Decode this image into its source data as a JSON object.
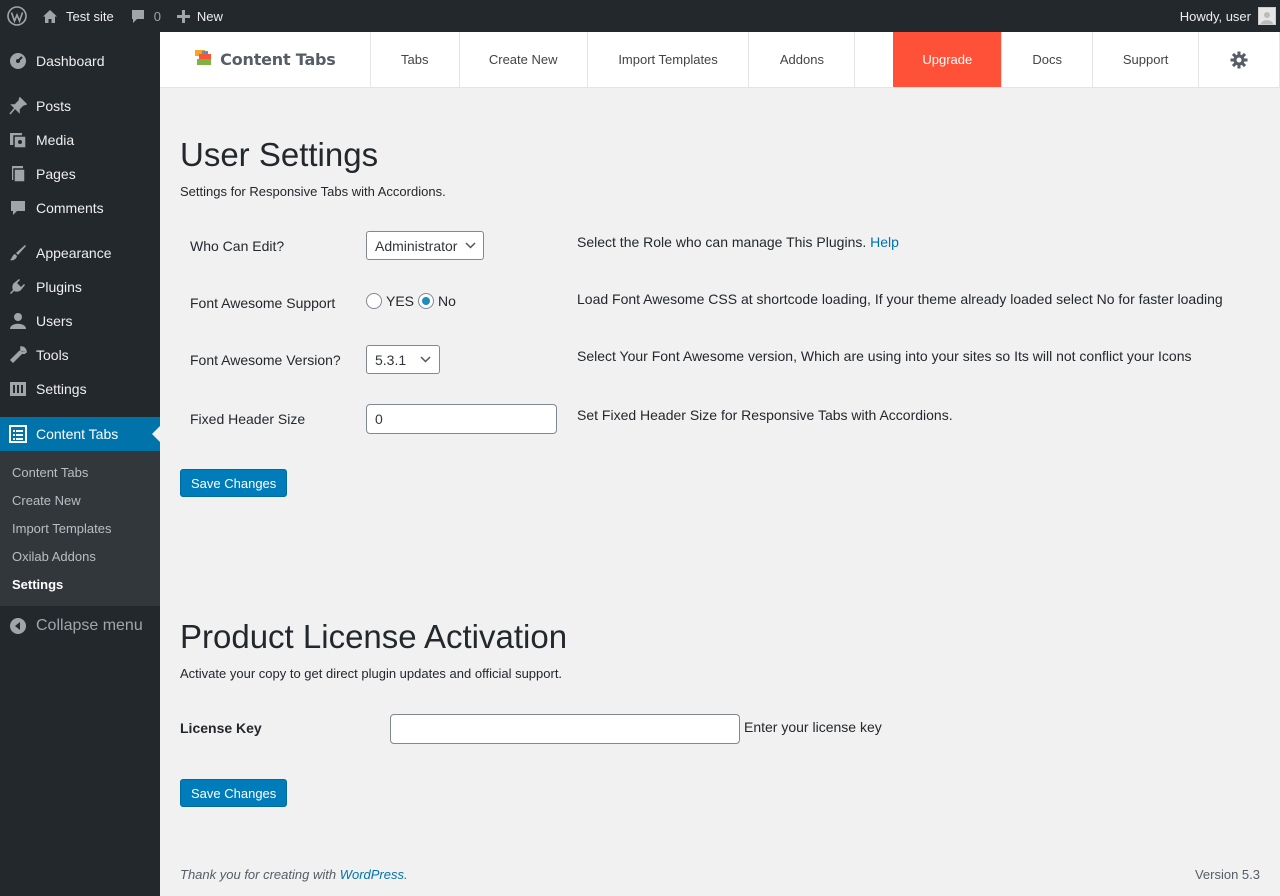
{
  "adminbar": {
    "site_name": "Test site",
    "comments_count": "0",
    "new_label": "New",
    "howdy": "Howdy, user"
  },
  "sidebar": {
    "items": [
      {
        "label": "Dashboard",
        "icon": "dashboard-icon"
      },
      {
        "label": "Posts",
        "icon": "pin-icon"
      },
      {
        "label": "Media",
        "icon": "media-icon"
      },
      {
        "label": "Pages",
        "icon": "pages-icon"
      },
      {
        "label": "Comments",
        "icon": "comment-icon"
      },
      {
        "label": "Appearance",
        "icon": "brush-icon"
      },
      {
        "label": "Plugins",
        "icon": "plugin-icon"
      },
      {
        "label": "Users",
        "icon": "user-icon"
      },
      {
        "label": "Tools",
        "icon": "wrench-icon"
      },
      {
        "label": "Settings",
        "icon": "settings-icon"
      },
      {
        "label": "Content Tabs",
        "icon": "list-icon"
      }
    ],
    "submenu": [
      "Content Tabs",
      "Create New",
      "Import Templates",
      "Oxilab Addons",
      "Settings"
    ],
    "collapse_label": "Collapse menu"
  },
  "plugin_nav": {
    "brand": "Content Tabs",
    "links": [
      "Tabs",
      "Create New",
      "Import Templates",
      "Addons"
    ],
    "upgrade": "Upgrade",
    "docs": "Docs",
    "support": "Support",
    "accent_color": "#fe5138"
  },
  "user_settings": {
    "title": "User Settings",
    "description": "Settings for Responsive Tabs with Accordions.",
    "rows": {
      "who_can_edit": {
        "label": "Who Can Edit?",
        "value": "Administrator",
        "desc": "Select the Role who can manage This Plugins.",
        "help": "Help"
      },
      "font_awesome_support": {
        "label": "Font Awesome Support",
        "option_yes": "YES",
        "option_no": "No",
        "selected": "No",
        "desc": "Load Font Awesome CSS at shortcode loading, If your theme already loaded select No for faster loading"
      },
      "font_awesome_version": {
        "label": "Font Awesome Version?",
        "value": "5.3.1",
        "desc": "Select Your Font Awesome version, Which are using into your sites so Its will not conflict your Icons"
      },
      "fixed_header_size": {
        "label": "Fixed Header Size",
        "value": "0",
        "desc": "Set Fixed Header Size for Responsive Tabs with Accordions."
      }
    },
    "save_label": "Save Changes"
  },
  "license": {
    "title": "Product License Activation",
    "description": "Activate your copy to get direct plugin updates and official support.",
    "key_label": "License Key",
    "key_value": "",
    "key_hint": "Enter your license key",
    "save_label": "Save Changes"
  },
  "footer": {
    "thanks_prefix": "Thank you for creating with ",
    "wordpress": "WordPress",
    "thanks_suffix": ".",
    "version": "Version 5.3"
  },
  "colors": {
    "admin_dark": "#23282d",
    "primary_blue": "#0073aa",
    "button_blue": "#007cba"
  }
}
